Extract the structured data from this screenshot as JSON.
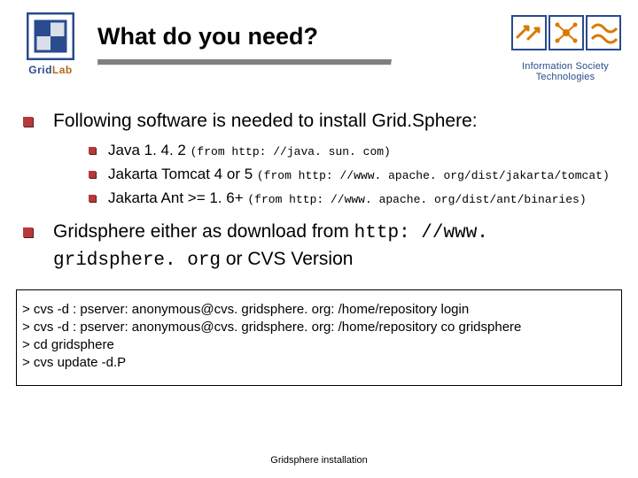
{
  "header": {
    "logo_gridlab": {
      "grid": "Grid",
      "lab": "Lab"
    },
    "title": "What do you need?",
    "logo_ist": {
      "line1": "Information Society",
      "line2": "Technologies"
    }
  },
  "content": {
    "bullet1": "Following software is needed to install Grid.Sphere:",
    "sub": [
      {
        "main": "Java 1. 4. 2 ",
        "from": "(from http: //java. sun. com)"
      },
      {
        "main": "Jakarta Tomcat 4 or 5 ",
        "from": "(from http: //www. apache. org/dist/jakarta/tomcat)"
      },
      {
        "main": "Jakarta Ant >= 1. 6+ ",
        "from": "(from http: //www. apache. org/dist/ant/binaries)"
      }
    ],
    "bullet2_pre": "Gridsphere either as download from ",
    "bullet2_url": "http: //www. gridsphere. org",
    "bullet2_post": " or CVS Version"
  },
  "codebox": [
    "> cvs -d : pserver: anonymous@cvs. gridsphere. org: /home/repository login",
    "> cvs -d : pserver: anonymous@cvs. gridsphere. org: /home/repository  co gridsphere",
    "> cd gridsphere",
    "> cvs update -d.P"
  ],
  "footer": "Gridsphere installation"
}
